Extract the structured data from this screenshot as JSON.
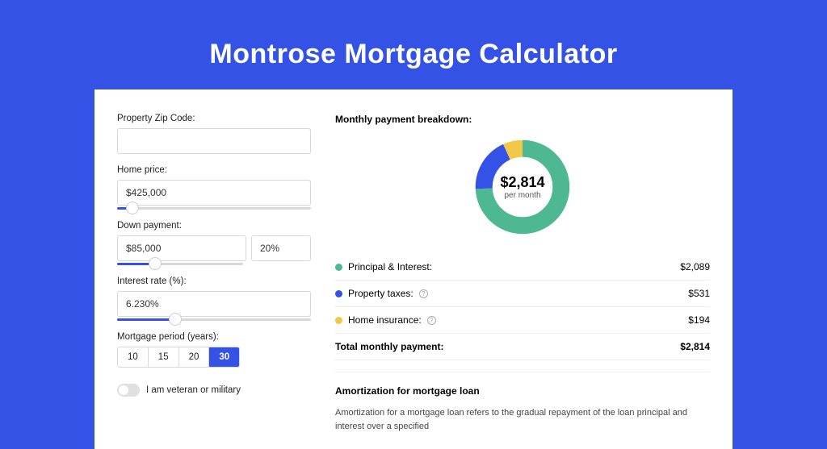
{
  "title": "Montrose Mortgage Calculator",
  "form": {
    "zip_label": "Property Zip Code:",
    "zip_value": "",
    "home_price_label": "Home price:",
    "home_price_value": "$425,000",
    "down_payment_label": "Down payment:",
    "down_payment_value": "$85,000",
    "down_payment_pct": "20%",
    "interest_label": "Interest rate (%):",
    "interest_value": "6.230%",
    "period_label": "Mortgage period (years):",
    "periods": [
      "10",
      "15",
      "20",
      "30"
    ],
    "period_active": "30",
    "veteran_label": "I am veteran or military"
  },
  "breakdown": {
    "title": "Monthly payment breakdown:",
    "donut_amount": "$2,814",
    "donut_sub": "per month",
    "rows": [
      {
        "label": "Principal & Interest:",
        "value": "$2,089",
        "color": "#4db892",
        "info": false
      },
      {
        "label": "Property taxes:",
        "value": "$531",
        "color": "#3452e5",
        "info": true
      },
      {
        "label": "Home insurance:",
        "value": "$194",
        "color": "#f2c849",
        "info": true
      }
    ],
    "total_label": "Total monthly payment:",
    "total_value": "$2,814"
  },
  "chart_data": {
    "type": "pie",
    "title": "Monthly payment breakdown",
    "series": [
      {
        "name": "Principal & Interest",
        "value": 2089,
        "color": "#4db892"
      },
      {
        "name": "Property taxes",
        "value": 531,
        "color": "#3452e5"
      },
      {
        "name": "Home insurance",
        "value": 194,
        "color": "#f2c849"
      }
    ],
    "total": 2814,
    "unit": "USD per month"
  },
  "amort": {
    "title": "Amortization for mortgage loan",
    "text": "Amortization for a mortgage loan refers to the gradual repayment of the loan principal and interest over a specified"
  }
}
